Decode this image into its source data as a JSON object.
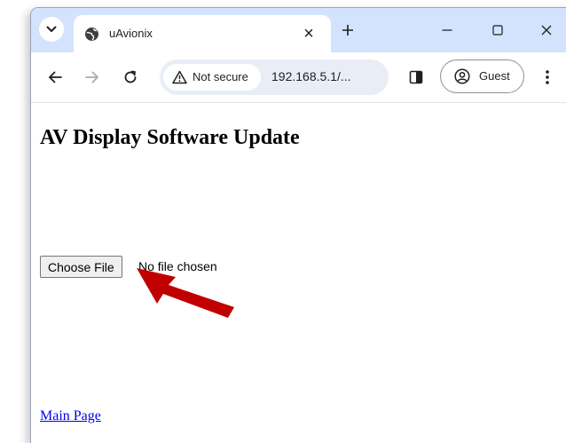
{
  "browser": {
    "tab": {
      "title": "uAvionix",
      "close_glyph": "×"
    },
    "address_bar": {
      "security_label": "Not secure",
      "url": "192.168.5.1/..."
    },
    "profile_label": "Guest"
  },
  "page": {
    "title": "AV Display Software Update",
    "file_input": {
      "button_label": "Choose File",
      "status": "No file chosen"
    },
    "main_link": "Main Page"
  },
  "annotation": {
    "arrow_color": "#c00000",
    "icon": "arrow-icon"
  },
  "colors": {
    "tabstrip_bg": "#d3e3fd",
    "omnibox_bg": "#e9eef6",
    "link": "#0000ee"
  }
}
